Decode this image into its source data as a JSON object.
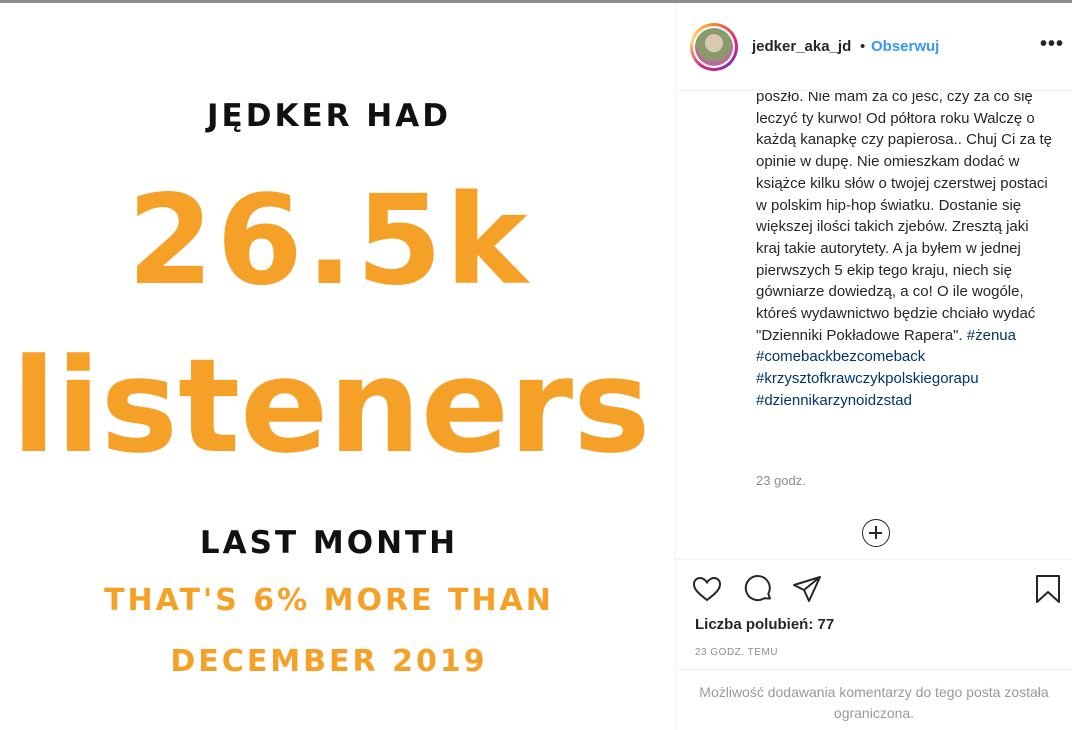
{
  "media": {
    "line1": "JĘDKER HAD",
    "big_number": "26.5k",
    "big_word": "listeners",
    "line2": "LAST MONTH",
    "line3": "THAT'S 6% MORE THAN",
    "line4": "DECEMBER 2019",
    "accent_color": "#f5a128"
  },
  "header": {
    "username": "jedker_aka_jd",
    "separator": "•",
    "follow_label": "Obserwuj",
    "more_label": "•••"
  },
  "caption": {
    "text": "poszło. Nie mam za co jeść, czy za co się leczyć ty kurwo! Od półtora roku Walczę o każdą kanapkę czy papierosa.. Chuj Ci za tę opinie w dupę. Nie omieszkam dodać w książce kilku słów o twojej czerstwej postaci w polskim hip-hop światku. Dostanie się większej ilości takich zjebów. Zresztą jaki kraj takie autorytety. A ja byłem w jednej pierwszych 5 ekip tego kraju, niech się gówniarze dowiedzą, a co! O ile wogóle, któreś wydawnictwo będzie chciało wydać \"Dzienniki Pokładowe Rapera\". ",
    "hashtags": [
      "#żenua",
      "#comebackbezcomeback",
      "#krzysztofkrawczykpolskiegorapu",
      "#dziennikarzynoidzstad"
    ],
    "time": "23 godz."
  },
  "actions": {
    "like_icon": "heart-icon",
    "comment_icon": "comment-icon",
    "share_icon": "share-icon",
    "save_icon": "bookmark-icon",
    "load_more_icon": "plus-circle-icon"
  },
  "likes": "Liczba polubień: 77",
  "ago": "23 GODZ. TEMU",
  "comments_disabled": "Możliwość dodawania komentarzy do tego posta została ograniczona.",
  "colors": {
    "link": "#3897f0",
    "hashtag": "#003569",
    "muted": "#8e8e8e"
  }
}
